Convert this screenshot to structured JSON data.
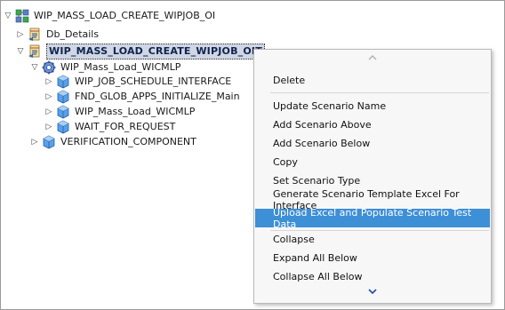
{
  "tree": {
    "root": {
      "label": "WIP_MASS_LOAD_CREATE_WIPJOB_OI",
      "toggle": "▽"
    },
    "db_details": {
      "label": "Db_Details",
      "toggle": "▷"
    },
    "selected": {
      "label": "WIP_MASS_LOAD_CREATE_WIPJOB_OIT",
      "toggle": "▽"
    },
    "component": {
      "label": "WIP_Mass_Load_WICMLP",
      "toggle": "▽"
    },
    "children": [
      {
        "label": "WIP_JOB_SCHEDULE_INTERFACE",
        "toggle": "▷"
      },
      {
        "label": "FND_GLOB_APPS_INITIALIZE_Main",
        "toggle": "▷"
      },
      {
        "label": "WIP_Mass_Load_WICMLP",
        "toggle": "▷"
      },
      {
        "label": "WAIT_FOR_REQUEST",
        "toggle": "▷"
      }
    ],
    "verification": {
      "label": "VERIFICATION_COMPONENT",
      "toggle": "▷"
    }
  },
  "context_menu": {
    "items": [
      {
        "label": "Delete"
      },
      {
        "label": "Update Scenario Name"
      },
      {
        "label": "Add Scenario Above"
      },
      {
        "label": "Add Scenario Below"
      },
      {
        "label": "Copy"
      },
      {
        "label": "Set Scenario Type"
      },
      {
        "label": "Generate Scenario Template Excel For Interface"
      },
      {
        "label": "Upload Excel and Populate Scenario Test Data",
        "highlighted": true
      },
      {
        "label": "Collapse"
      },
      {
        "label": "Expand All Below"
      },
      {
        "label": "Collapse All Below"
      }
    ]
  },
  "colors": {
    "menu_highlight": "#3d8fd6",
    "selection_bg": "#cfd6e4",
    "cube_icon": "#3a87d8"
  },
  "icons": {
    "root": "scenario-group-icon",
    "scenario": "scenario-icon",
    "component": "component-gear-icon",
    "step": "cube-icon",
    "scroll_up": "chevron-up-icon",
    "scroll_down": "chevron-down-icon"
  }
}
